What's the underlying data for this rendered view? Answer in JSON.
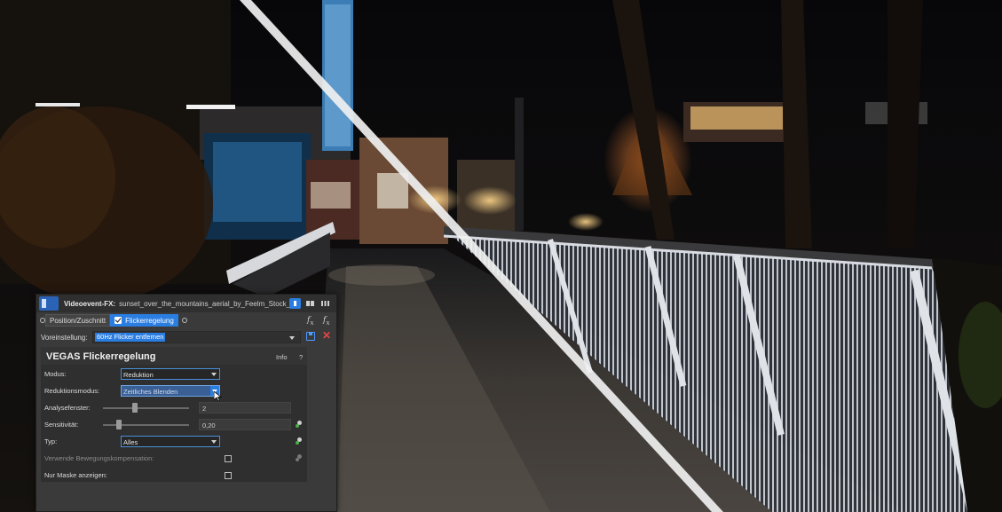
{
  "fx_window": {
    "title": "Videoevent-FX:",
    "source_name": "sunset_over_the_mountains_aerial_by_Feelm_Stock_A",
    "chain": {
      "plugin1": "Position/Zuschnitt",
      "plugin2": "Flickerregelung"
    },
    "preset": {
      "label": "Voreinstellung:",
      "value": "60Hz Flicker entfernen"
    },
    "panel": {
      "title": "VEGAS Flickerregelung",
      "info": "Info",
      "help": "?",
      "rows": {
        "modus": {
          "label": "Modus:",
          "value": "Reduktion"
        },
        "reduktionsmodus": {
          "label": "Reduktionsmodus:",
          "value": "Zeitliches Blenden"
        },
        "analysefenster": {
          "label": "Analysefenster:",
          "value": "2",
          "level": 0.38
        },
        "sensitivitaet": {
          "label": "Sensitivität:",
          "value": "0,20",
          "level": 0.2
        },
        "typ": {
          "label": "Typ:",
          "value": "Alles"
        },
        "bewegung": {
          "label": "Verwende Bewegungskompensation:",
          "checked": false
        },
        "maske": {
          "label": "Nur Maske anzeigen:",
          "checked": false
        }
      }
    },
    "colors": {
      "accent": "#2a7de1",
      "window_bg": "#3a3a3a",
      "panel_bg": "#2f2f2f",
      "delete": "#e34646"
    },
    "icons": [
      "app-icon",
      "fx-icon",
      "save-icon",
      "delete-icon",
      "grid-icon",
      "checkbox-icon",
      "keyframe-icon",
      "cursor-icon"
    ]
  }
}
